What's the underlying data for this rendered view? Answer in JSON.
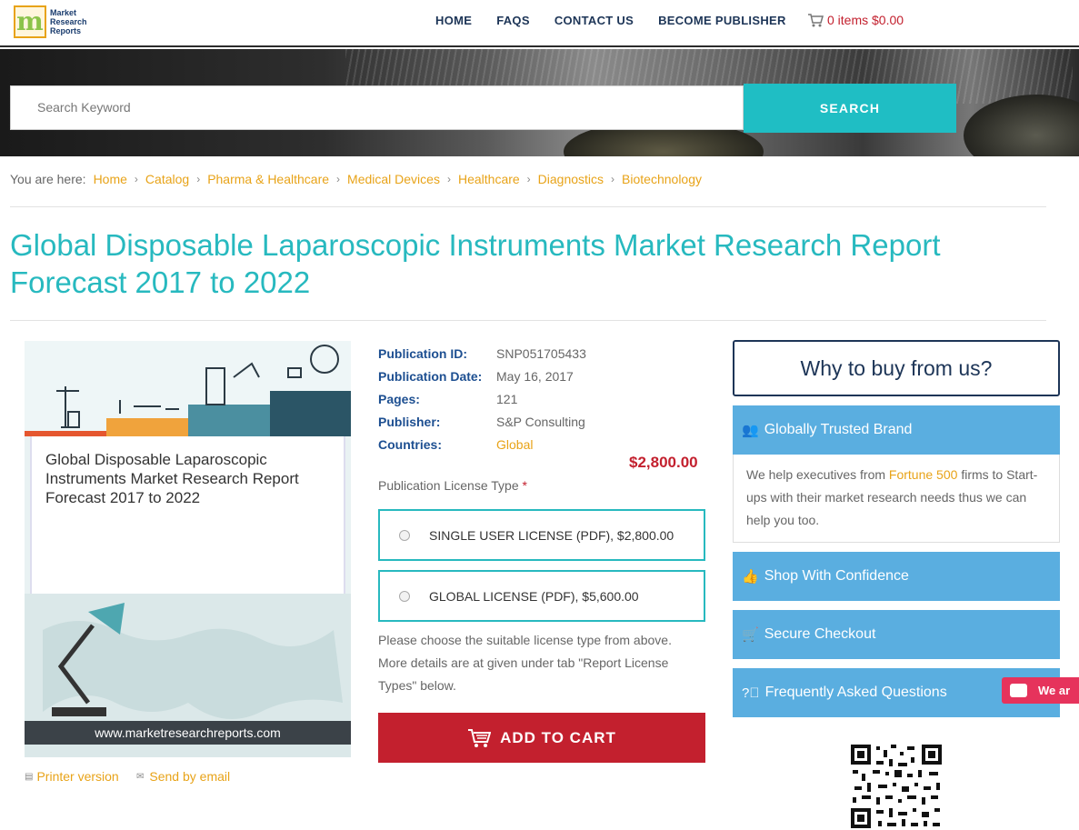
{
  "header": {
    "logo_lines": [
      "Market",
      "Research",
      "Reports"
    ],
    "nav": [
      "HOME",
      "FAQS",
      "CONTACT US",
      "BECOME PUBLISHER"
    ],
    "cart_text": "0 items $0.00"
  },
  "search": {
    "placeholder": "Search Keyword",
    "button": "SEARCH"
  },
  "breadcrumb": {
    "label": "You are here:",
    "items": [
      "Home",
      "Catalog",
      "Pharma & Healthcare",
      "Medical Devices",
      "Healthcare",
      "Diagnostics",
      "Biotechnology"
    ]
  },
  "title": "Global Disposable Laparoscopic Instruments Market Research Report Forecast 2017 to 2022",
  "cover": {
    "title": "Global Disposable Laparoscopic Instruments Market Research Report Forecast 2017 to 2022",
    "url": "www.marketresearchreports.com"
  },
  "links": {
    "printer": "Printer version",
    "email": "Send by email"
  },
  "meta": [
    {
      "key": "Publication ID:",
      "value": "SNP051705433"
    },
    {
      "key": "Publication Date:",
      "value": "May 16, 2017"
    },
    {
      "key": "Pages:",
      "value": "121"
    },
    {
      "key": "Publisher:",
      "value": "S&P Consulting"
    },
    {
      "key": "Countries:",
      "value": "Global"
    }
  ],
  "price": "$2,800.00",
  "license": {
    "label": "Publication License Type",
    "required": "*",
    "options": [
      "SINGLE USER LICENSE (PDF), $2,800.00",
      "GLOBAL LICENSE (PDF), $5,600.00"
    ],
    "note": "Please choose the suitable license type from above. More details are at given under tab \"Report License Types\" below."
  },
  "add_to_cart": "ADD TO CART",
  "sidebar": {
    "why": "Why to buy from us?",
    "trusted": "Globally Trusted Brand",
    "trusted_text_1": "We help executives from",
    "trusted_highlight": "Fortune 500",
    "trusted_text_2": "firms to Start-ups with their market research needs thus we can help you too.",
    "shop": "Shop With Confidence",
    "checkout": "Secure Checkout",
    "faq": "Frequently Asked Questions"
  },
  "chat": "We ar",
  "colors": {
    "accent": "#27b9bf",
    "link": "#e8a318",
    "red": "#c3202e",
    "navy": "#1d3557",
    "sidebar": "#5aaee0"
  }
}
